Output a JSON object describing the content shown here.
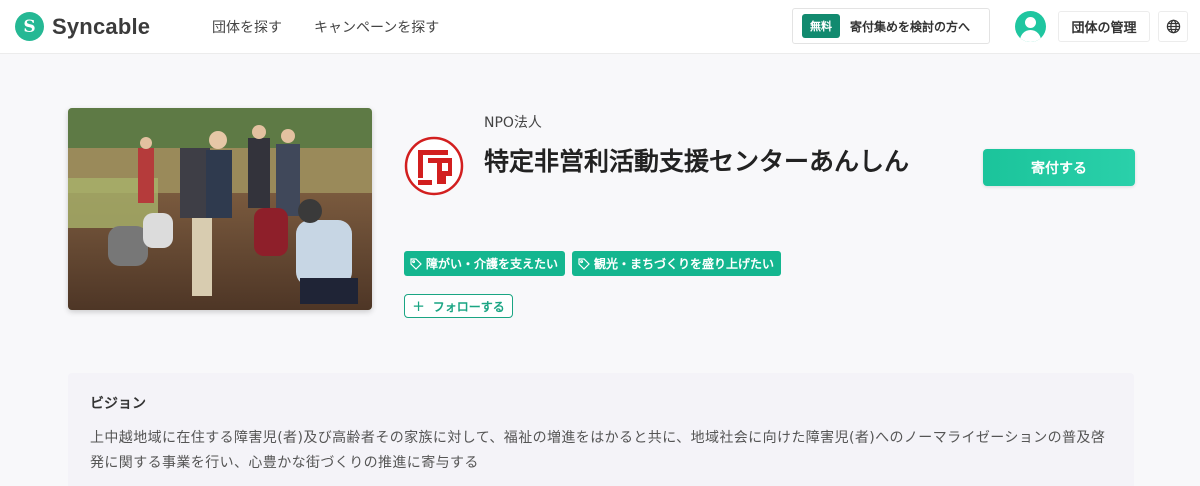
{
  "header": {
    "logo_mark": "S",
    "logo_text": "Syncable",
    "nav": [
      "団体を探す",
      "キャンペーンを探す"
    ],
    "promo_badge": "無料",
    "promo_text": "寄付集めを検討の方へ",
    "manage_label": "団体の管理",
    "lang_icon": "globe-icon",
    "avatar_icon": "user-icon"
  },
  "org": {
    "type": "NPO法人",
    "name": "特定非営利活動支援センターあんしん",
    "donate_label": "寄付する",
    "follow_label": "フォローする",
    "tags": [
      "障がい・介護を支えたい",
      "観光・まちづくりを盛り上げたい"
    ]
  },
  "vision": {
    "title": "ビジョン",
    "text": "上中越地域に在住する障害児(者)及び高齢者その家族に対して、福祉の増進をはかると共に、地域社会に向けた障害児(者)へのノーマライゼーションの普及啓発に関する事業を行い、心豊かな街づくりの推進に寄与する"
  },
  "colors": {
    "brand": "#25b894",
    "tag": "#14b68f",
    "donate": "#1bc49b",
    "logo_red": "#d21f1f"
  }
}
